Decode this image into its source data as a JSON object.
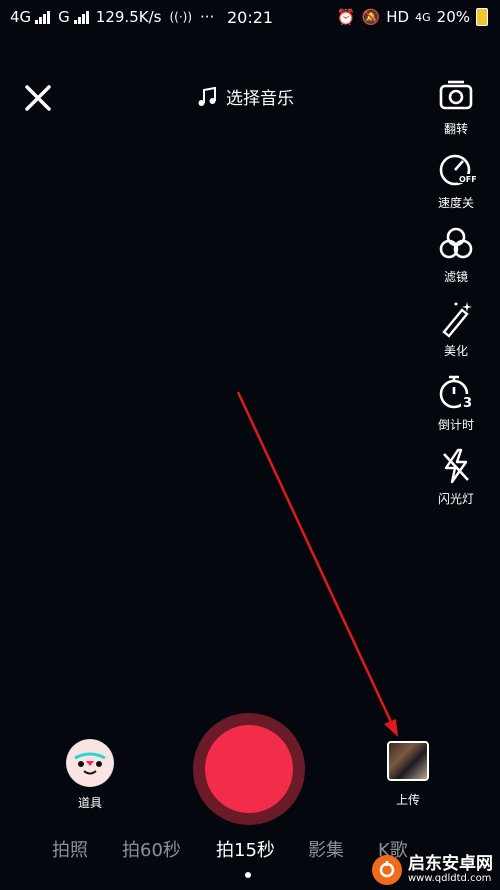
{
  "status_bar": {
    "network1": "4G",
    "network2": "G",
    "speed": "129.5K/s",
    "more": "···",
    "time": "20:21",
    "hd": "HD",
    "net_badge": "4G",
    "battery": "20%"
  },
  "header": {
    "music_label": "选择音乐"
  },
  "tools": [
    {
      "label": "翻转",
      "icon": "flip-camera-icon"
    },
    {
      "label": "速度关",
      "icon": "speed-off-icon"
    },
    {
      "label": "滤镜",
      "icon": "filter-icon"
    },
    {
      "label": "美化",
      "icon": "beautify-wand-icon"
    },
    {
      "label": "倒计时",
      "icon": "countdown-timer-icon"
    },
    {
      "label": "闪光灯",
      "icon": "flash-off-icon"
    }
  ],
  "bottom": {
    "props_label": "道具",
    "upload_label": "上传"
  },
  "modes": [
    "拍照",
    "拍60秒",
    "拍15秒",
    "影集",
    "K歌"
  ],
  "active_mode": "拍15秒",
  "watermark": {
    "name": "启东安卓网",
    "url": "www.qdldtd.com"
  },
  "colors": {
    "background": "#04070d",
    "record": "#f32c49",
    "record_ring": "#6b1b28",
    "arrow": "#e01a1a",
    "inactive_mode": "#8e9094"
  }
}
